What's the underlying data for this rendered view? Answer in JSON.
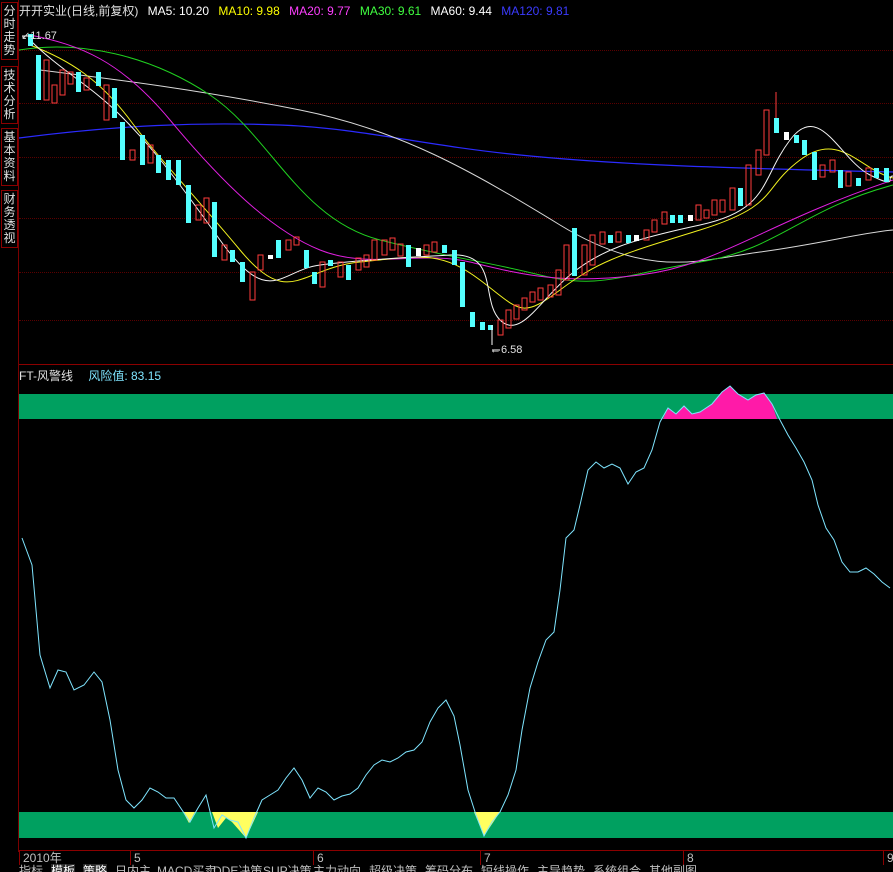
{
  "sidebar": {
    "tabs": [
      "分时走势",
      "技术分析",
      "基本资料",
      "财务透视"
    ]
  },
  "header": {
    "stock": "开开实业(日线,前复权)",
    "ma": [
      {
        "label": "MA5: 10.20",
        "color": "#ffffff"
      },
      {
        "label": "MA10: 9.98",
        "color": "#ffff00"
      },
      {
        "label": "MA20: 9.77",
        "color": "#ff00ff"
      },
      {
        "label": "MA30: 9.61",
        "color": "#00ff00"
      },
      {
        "label": "MA60: 9.44",
        "color": "#ffffff"
      },
      {
        "label": "MA120: 9.81",
        "color": "#3b3bff"
      }
    ]
  },
  "price_marks": {
    "high": "11.67",
    "low": "6.58"
  },
  "indicator": {
    "name": "FT-风警线",
    "risk_label": "风险值: 83.15"
  },
  "colors": {
    "up": "#ff3b3b",
    "down": "#54ffff",
    "band": "#00a060",
    "top_fill": "#ff1aa8",
    "bottom_fill": "#ffff60",
    "risk_line": "#7fe5ff",
    "grid": "#8b0000"
  },
  "time_axis": [
    "2010年",
    "5",
    "6",
    "7",
    "8",
    "9"
  ],
  "bottom_tabs": [
    "指标",
    "模板",
    "策略",
    "日内主",
    "MACD买卖",
    "DDE决策",
    "SUP决策",
    "主力动向",
    "超级决策",
    "筹码分布",
    "短线操作",
    "主导趋势",
    "系统组合",
    "其他副图"
  ]
}
